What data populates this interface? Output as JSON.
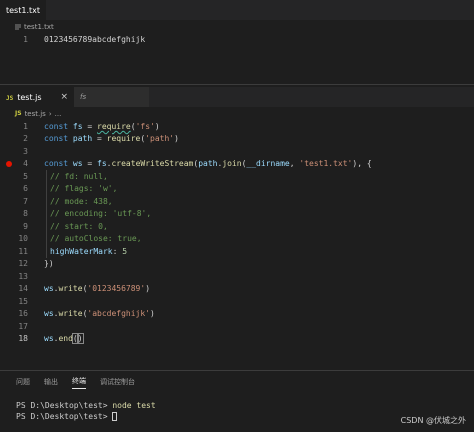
{
  "top_editor": {
    "tab_label": "test1.txt",
    "breadcrumb": "test1.txt",
    "lines": [
      {
        "num": "1",
        "text": "0123456789abcdefghijk"
      }
    ]
  },
  "bottom_editor": {
    "tabs": [
      {
        "badge": "JS",
        "label": "test.js",
        "close": "×"
      },
      {
        "badge": "fs",
        "label": ""
      }
    ],
    "breadcrumb": [
      "test.js",
      "..."
    ],
    "line_numbers": [
      "1",
      "2",
      "3",
      "4",
      "5",
      "6",
      "7",
      "8",
      "9",
      "10",
      "11",
      "12",
      "13",
      "14",
      "15",
      "16",
      "17",
      "18"
    ],
    "code": {
      "l1": {
        "kw": "const",
        "var": "fs",
        "eq": " = ",
        "fn": "require",
        "arg": "'fs'"
      },
      "l2": {
        "kw": "const",
        "var": "path",
        "eq": " = ",
        "fn": "require",
        "arg": "'path'"
      },
      "l4": {
        "kw": "const",
        "var": "ws",
        "eq": " = ",
        "obj": "fs",
        "fn": "createWriteStream",
        "obj2": "path",
        "fn2": "join",
        "v2": "__dirname",
        "arg": "'test1.txt'"
      },
      "comments": [
        "// fd: null,",
        "// flags: 'w',",
        "// mode: 438,",
        "// encoding: 'utf-8',",
        "// start: 0,",
        "// autoClose: true,"
      ],
      "l11": {
        "prop": "highWaterMark",
        "val": "5"
      },
      "l12": "})",
      "l14": {
        "obj": "ws",
        "fn": "write",
        "arg": "'0123456789'"
      },
      "l16": {
        "obj": "ws",
        "fn": "write",
        "arg": "'abcdefghijk'"
      },
      "l18": {
        "obj": "ws",
        "fn": "end"
      }
    }
  },
  "panel": {
    "tabs": [
      "问题",
      "输出",
      "终端",
      "调试控制台"
    ],
    "active_tab": "终端",
    "terminal_lines": [
      {
        "prompt": "PS D:\\Desktop\\test>",
        "cmd": "node test"
      },
      {
        "prompt": "PS D:\\Desktop\\test>",
        "cmd": ""
      }
    ]
  },
  "watermark": "CSDN @伏城之外"
}
